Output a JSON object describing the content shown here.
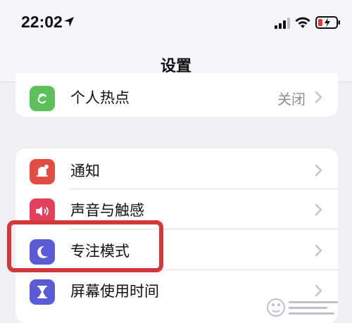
{
  "status_bar": {
    "time": "22:02",
    "icons": [
      "location-arrow-icon",
      "cellular-signal-icon",
      "wifi-icon",
      "battery-charging-icon"
    ]
  },
  "nav": {
    "title": "设置"
  },
  "groups": [
    {
      "items": [
        {
          "label": "个人热点",
          "value": "关闭",
          "icon": "hotspot-icon",
          "icon_color": "#5cc05b"
        }
      ]
    },
    {
      "items": [
        {
          "label": "通知",
          "icon": "bell-icon",
          "icon_color": "#e24c43"
        },
        {
          "label": "声音与触感",
          "icon": "speaker-icon",
          "icon_color": "#e2415c"
        },
        {
          "label": "专注模式",
          "icon": "moon-icon",
          "icon_color": "#5b5bd6"
        },
        {
          "label": "屏幕使用时间",
          "icon": "hourglass-icon",
          "icon_color": "#5b5bd6"
        }
      ]
    }
  ],
  "highlight": {
    "target": "专注模式",
    "color": "#d43838"
  }
}
